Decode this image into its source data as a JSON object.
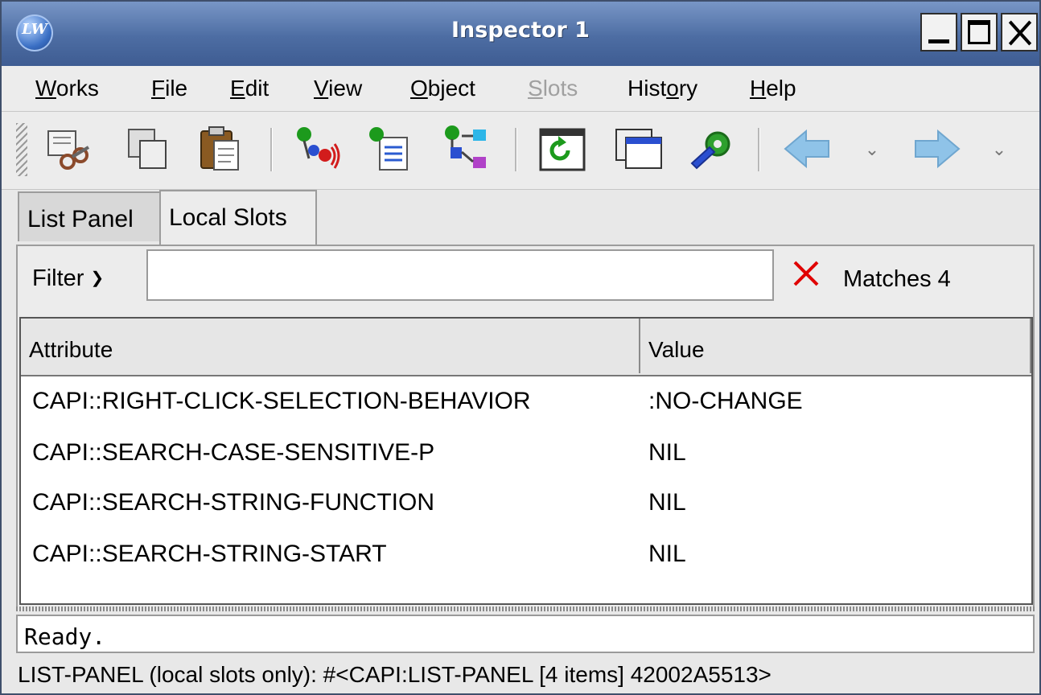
{
  "window": {
    "title": "Inspector 1",
    "logo_text": "LW"
  },
  "menubar": {
    "items": [
      {
        "mnemonic": "W",
        "rest": "orks",
        "label": "Works",
        "enabled": true
      },
      {
        "mnemonic": "F",
        "rest": "ile",
        "label": "File",
        "enabled": true
      },
      {
        "mnemonic": "E",
        "rest": "dit",
        "label": "Edit",
        "enabled": true
      },
      {
        "mnemonic": "V",
        "rest": "iew",
        "label": "View",
        "enabled": true
      },
      {
        "mnemonic": "O",
        "rest": "bject",
        "label": "Object",
        "enabled": true
      },
      {
        "mnemonic": "S",
        "rest": "lots",
        "label": "Slots",
        "enabled": false
      },
      {
        "pre": "Hist",
        "mnemonic": "o",
        "rest": "ry",
        "label": "History",
        "enabled": true
      },
      {
        "mnemonic": "H",
        "rest": "elp",
        "label": "Help",
        "enabled": true
      }
    ]
  },
  "toolbar": {
    "buttons": [
      "cut-icon",
      "copy-icon",
      "paste-icon",
      "browse-object-icon",
      "inspect-icon",
      "class-browser-icon",
      "refresh-icon",
      "new-window-icon",
      "tools-icon",
      "back-icon",
      "forward-icon"
    ]
  },
  "tabs": {
    "list_panel": "List Panel",
    "local_slots": "Local Slots",
    "active": "local_slots"
  },
  "filter": {
    "label": "Filter",
    "value": "",
    "matches_label": "Matches 4"
  },
  "table": {
    "columns": [
      "Attribute",
      "Value"
    ],
    "rows": [
      {
        "attribute": "CAPI::RIGHT-CLICK-SELECTION-BEHAVIOR",
        "value": ":NO-CHANGE"
      },
      {
        "attribute": "CAPI::SEARCH-CASE-SENSITIVE-P",
        "value": "NIL"
      },
      {
        "attribute": "CAPI::SEARCH-STRING-FUNCTION",
        "value": "NIL"
      },
      {
        "attribute": "CAPI::SEARCH-STRING-START",
        "value": "NIL"
      }
    ]
  },
  "status": {
    "message": "Ready.",
    "footer": "LIST-PANEL (local slots only): #<CAPI:LIST-PANEL [4 items] 42002A5513>"
  },
  "colors": {
    "titlebar": "#4d6da3",
    "clear_x": "#e00000",
    "disabled_text": "#a0a0a0"
  }
}
